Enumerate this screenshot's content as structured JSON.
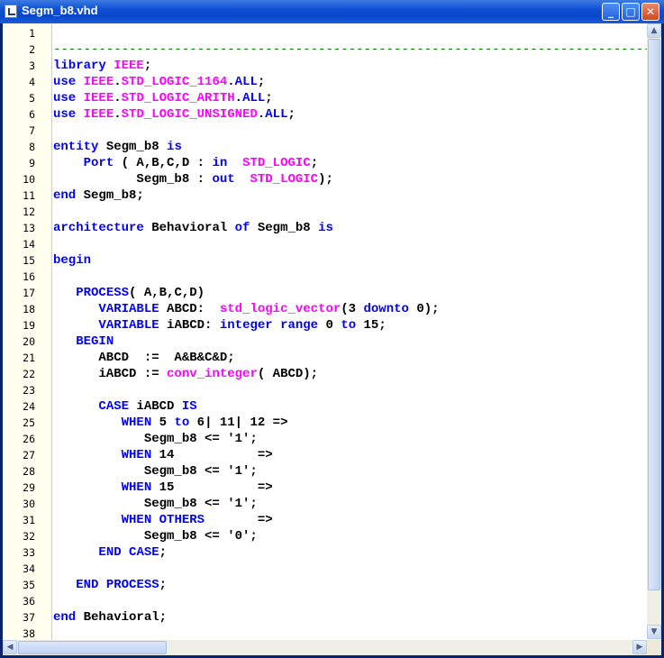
{
  "window": {
    "title": "Segm_b8.vhd",
    "minimize_glyph": "_",
    "maximize_glyph": "□",
    "close_glyph": "✕",
    "icon": "document-icon"
  },
  "colors": {
    "keyword": "#0000ff",
    "type": "#ff00ff",
    "comment": "#008000",
    "text": "#000000",
    "gutter": "#fffff0"
  },
  "scrollbars": {
    "up_glyph": "▲",
    "down_glyph": "▼",
    "left_glyph": "◀",
    "right_glyph": "▶"
  },
  "lines": [
    {
      "n": "1",
      "tokens": []
    },
    {
      "n": "2",
      "tokens": [
        {
          "t": "------------------------------------------------------------------------------------",
          "c": "cm"
        }
      ]
    },
    {
      "n": "3",
      "tokens": [
        {
          "t": "library",
          "c": "kw"
        },
        {
          "t": " ",
          "c": ""
        },
        {
          "t": "IEEE",
          "c": "ty"
        },
        {
          "t": ";",
          "c": ""
        }
      ]
    },
    {
      "n": "4",
      "tokens": [
        {
          "t": "use",
          "c": "kw"
        },
        {
          "t": " ",
          "c": ""
        },
        {
          "t": "IEEE",
          "c": "ty"
        },
        {
          "t": ".",
          "c": ""
        },
        {
          "t": "STD_LOGIC_1164",
          "c": "ty"
        },
        {
          "t": ".",
          "c": ""
        },
        {
          "t": "ALL",
          "c": "kw"
        },
        {
          "t": ";",
          "c": ""
        }
      ]
    },
    {
      "n": "5",
      "tokens": [
        {
          "t": "use",
          "c": "kw"
        },
        {
          "t": " ",
          "c": ""
        },
        {
          "t": "IEEE",
          "c": "ty"
        },
        {
          "t": ".",
          "c": ""
        },
        {
          "t": "STD_LOGIC_ARITH",
          "c": "ty"
        },
        {
          "t": ".",
          "c": ""
        },
        {
          "t": "ALL",
          "c": "kw"
        },
        {
          "t": ";",
          "c": ""
        }
      ]
    },
    {
      "n": "6",
      "tokens": [
        {
          "t": "use",
          "c": "kw"
        },
        {
          "t": " ",
          "c": ""
        },
        {
          "t": "IEEE",
          "c": "ty"
        },
        {
          "t": ".",
          "c": ""
        },
        {
          "t": "STD_LOGIC_UNSIGNED",
          "c": "ty"
        },
        {
          "t": ".",
          "c": ""
        },
        {
          "t": "ALL",
          "c": "kw"
        },
        {
          "t": ";",
          "c": ""
        }
      ]
    },
    {
      "n": "7",
      "tokens": []
    },
    {
      "n": "8",
      "tokens": [
        {
          "t": "entity",
          "c": "kw"
        },
        {
          "t": " Segm_b8 ",
          "c": ""
        },
        {
          "t": "is",
          "c": "kw"
        }
      ]
    },
    {
      "n": "9",
      "tokens": [
        {
          "t": "    ",
          "c": ""
        },
        {
          "t": "Port",
          "c": "kw"
        },
        {
          "t": " ( A,B,C,D : ",
          "c": ""
        },
        {
          "t": "in",
          "c": "kw"
        },
        {
          "t": "  ",
          "c": ""
        },
        {
          "t": "STD_LOGIC",
          "c": "ty"
        },
        {
          "t": ";",
          "c": ""
        }
      ]
    },
    {
      "n": "10",
      "tokens": [
        {
          "t": "           Segm_b8 : ",
          "c": ""
        },
        {
          "t": "out",
          "c": "kw"
        },
        {
          "t": "  ",
          "c": ""
        },
        {
          "t": "STD_LOGIC",
          "c": "ty"
        },
        {
          "t": ");",
          "c": ""
        }
      ]
    },
    {
      "n": "11",
      "tokens": [
        {
          "t": "end",
          "c": "kw"
        },
        {
          "t": " Segm_b8;",
          "c": ""
        }
      ]
    },
    {
      "n": "12",
      "tokens": []
    },
    {
      "n": "13",
      "tokens": [
        {
          "t": "architecture",
          "c": "kw"
        },
        {
          "t": " Behavioral ",
          "c": ""
        },
        {
          "t": "of",
          "c": "kw"
        },
        {
          "t": " Segm_b8 ",
          "c": ""
        },
        {
          "t": "is",
          "c": "kw"
        }
      ]
    },
    {
      "n": "14",
      "tokens": []
    },
    {
      "n": "15",
      "tokens": [
        {
          "t": "begin",
          "c": "kw"
        }
      ]
    },
    {
      "n": "16",
      "tokens": []
    },
    {
      "n": "17",
      "tokens": [
        {
          "t": "   ",
          "c": ""
        },
        {
          "t": "PROCESS",
          "c": "kw"
        },
        {
          "t": "( A,B,C,D)",
          "c": ""
        }
      ]
    },
    {
      "n": "18",
      "tokens": [
        {
          "t": "      ",
          "c": ""
        },
        {
          "t": "VARIABLE",
          "c": "kw"
        },
        {
          "t": " ABCD:  ",
          "c": ""
        },
        {
          "t": "std_logic_vector",
          "c": "ty"
        },
        {
          "t": "(3 ",
          "c": ""
        },
        {
          "t": "downto",
          "c": "kw"
        },
        {
          "t": " 0);",
          "c": ""
        }
      ]
    },
    {
      "n": "19",
      "tokens": [
        {
          "t": "      ",
          "c": ""
        },
        {
          "t": "VARIABLE",
          "c": "kw"
        },
        {
          "t": " iABCD: ",
          "c": ""
        },
        {
          "t": "integer",
          "c": "kw"
        },
        {
          "t": " ",
          "c": ""
        },
        {
          "t": "range",
          "c": "kw"
        },
        {
          "t": " 0 ",
          "c": ""
        },
        {
          "t": "to",
          "c": "kw"
        },
        {
          "t": " 15;",
          "c": ""
        }
      ]
    },
    {
      "n": "20",
      "tokens": [
        {
          "t": "   ",
          "c": ""
        },
        {
          "t": "BEGIN",
          "c": "kw"
        }
      ]
    },
    {
      "n": "21",
      "tokens": [
        {
          "t": "      ABCD  :=  A&B&C&D;",
          "c": ""
        }
      ]
    },
    {
      "n": "22",
      "tokens": [
        {
          "t": "      iABCD := ",
          "c": ""
        },
        {
          "t": "conv_integer",
          "c": "ty"
        },
        {
          "t": "( ABCD);",
          "c": ""
        }
      ]
    },
    {
      "n": "23",
      "tokens": []
    },
    {
      "n": "24",
      "tokens": [
        {
          "t": "      ",
          "c": ""
        },
        {
          "t": "CASE",
          "c": "kw"
        },
        {
          "t": " iABCD ",
          "c": ""
        },
        {
          "t": "IS",
          "c": "kw"
        }
      ]
    },
    {
      "n": "25",
      "tokens": [
        {
          "t": "         ",
          "c": ""
        },
        {
          "t": "WHEN",
          "c": "kw"
        },
        {
          "t": " 5 ",
          "c": ""
        },
        {
          "t": "to",
          "c": "kw"
        },
        {
          "t": " 6| 11| 12 =>",
          "c": ""
        }
      ]
    },
    {
      "n": "26",
      "tokens": [
        {
          "t": "            Segm_b8 <= '1';",
          "c": ""
        }
      ]
    },
    {
      "n": "27",
      "tokens": [
        {
          "t": "         ",
          "c": ""
        },
        {
          "t": "WHEN",
          "c": "kw"
        },
        {
          "t": " 14           =>",
          "c": ""
        }
      ]
    },
    {
      "n": "28",
      "tokens": [
        {
          "t": "            Segm_b8 <= '1';",
          "c": ""
        }
      ]
    },
    {
      "n": "29",
      "tokens": [
        {
          "t": "         ",
          "c": ""
        },
        {
          "t": "WHEN",
          "c": "kw"
        },
        {
          "t": " 15           =>",
          "c": ""
        }
      ]
    },
    {
      "n": "30",
      "tokens": [
        {
          "t": "            Segm_b8 <= '1';",
          "c": ""
        }
      ]
    },
    {
      "n": "31",
      "tokens": [
        {
          "t": "         ",
          "c": ""
        },
        {
          "t": "WHEN",
          "c": "kw"
        },
        {
          "t": " ",
          "c": ""
        },
        {
          "t": "OTHERS",
          "c": "kw"
        },
        {
          "t": "       =>",
          "c": ""
        }
      ]
    },
    {
      "n": "32",
      "tokens": [
        {
          "t": "            Segm_b8 <= '0';",
          "c": ""
        }
      ]
    },
    {
      "n": "33",
      "tokens": [
        {
          "t": "      ",
          "c": ""
        },
        {
          "t": "END",
          "c": "kw"
        },
        {
          "t": " ",
          "c": ""
        },
        {
          "t": "CASE",
          "c": "kw"
        },
        {
          "t": ";",
          "c": ""
        }
      ]
    },
    {
      "n": "34",
      "tokens": []
    },
    {
      "n": "35",
      "tokens": [
        {
          "t": "   ",
          "c": ""
        },
        {
          "t": "END",
          "c": "kw"
        },
        {
          "t": " ",
          "c": ""
        },
        {
          "t": "PROCESS",
          "c": "kw"
        },
        {
          "t": ";",
          "c": ""
        }
      ]
    },
    {
      "n": "36",
      "tokens": []
    },
    {
      "n": "37",
      "tokens": [
        {
          "t": "end",
          "c": "kw"
        },
        {
          "t": " Behavioral;",
          "c": ""
        }
      ]
    },
    {
      "n": "38",
      "tokens": []
    }
  ]
}
